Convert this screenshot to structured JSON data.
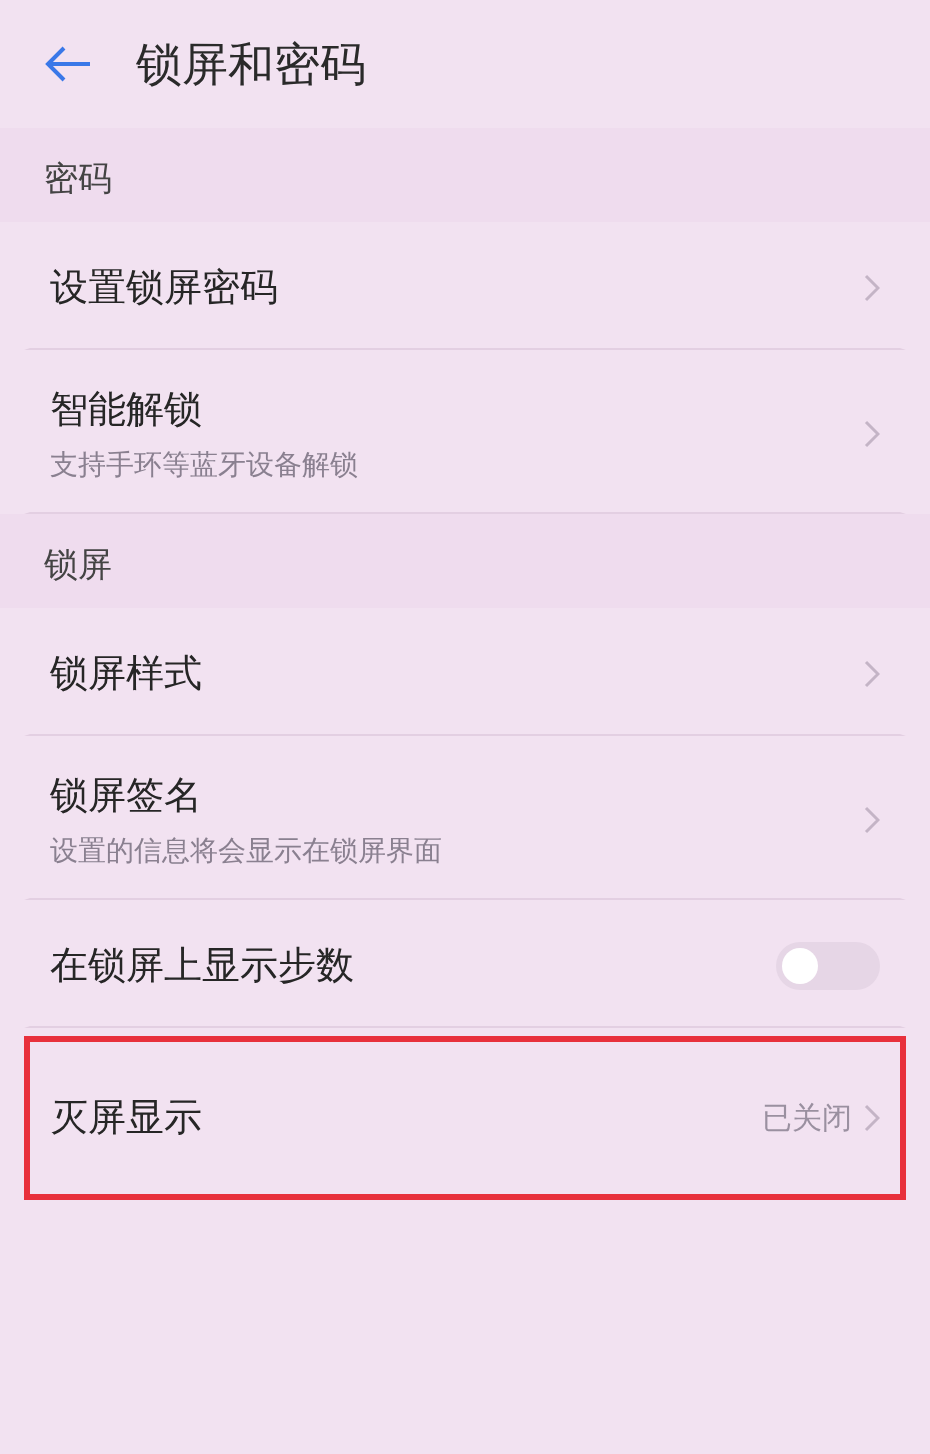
{
  "header": {
    "title": "锁屏和密码"
  },
  "sections": [
    {
      "title": "密码",
      "items": [
        {
          "kind": "link",
          "label": "设置锁屏密码",
          "highlighted": false
        },
        {
          "kind": "link",
          "label": "智能解锁",
          "subtitle": "支持手环等蓝牙设备解锁",
          "highlighted": false
        }
      ]
    },
    {
      "title": "锁屏",
      "items": [
        {
          "kind": "link",
          "label": "锁屏样式",
          "highlighted": false
        },
        {
          "kind": "link",
          "label": "锁屏签名",
          "subtitle": "设置的信息将会显示在锁屏界面",
          "highlighted": false
        },
        {
          "kind": "toggle",
          "label": "在锁屏上显示步数",
          "on": false,
          "highlighted": false
        },
        {
          "kind": "value",
          "label": "灭屏显示",
          "value": "已关闭",
          "highlighted": true
        }
      ]
    }
  ]
}
